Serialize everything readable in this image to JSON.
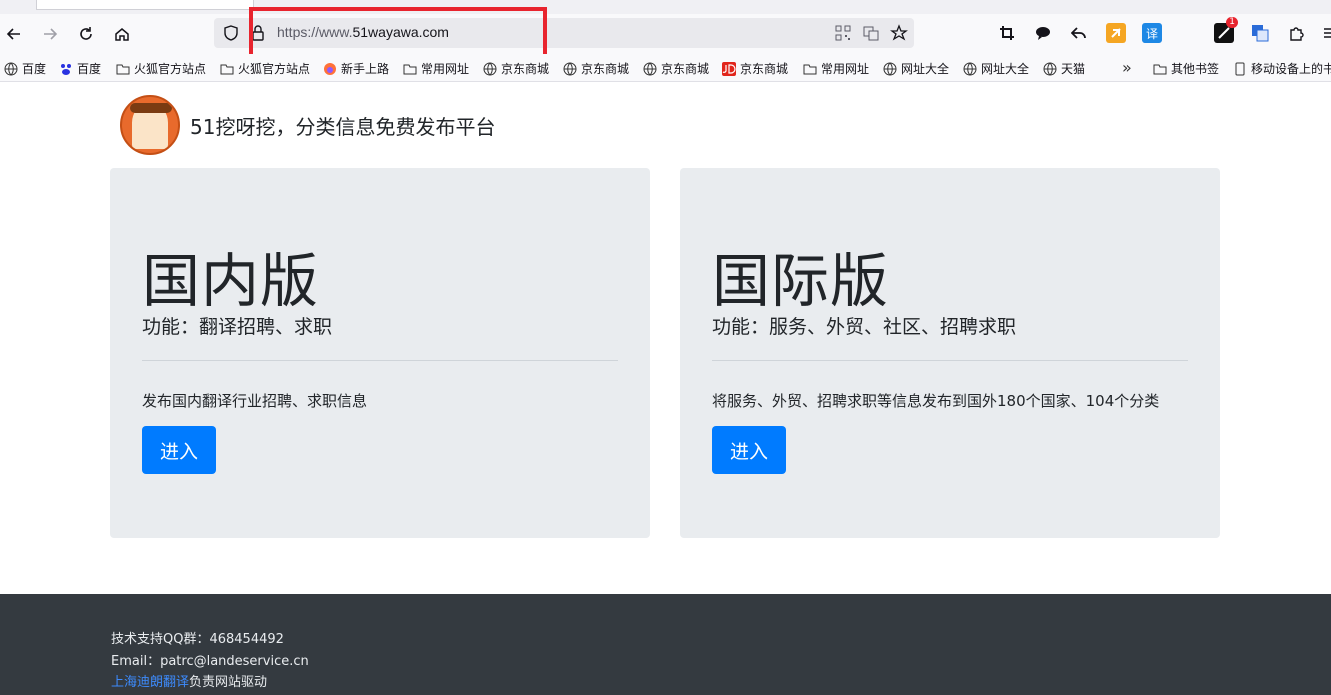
{
  "browser": {
    "url_prefix": "https://www.",
    "url_domain": "51wayawa.com",
    "bookmarks": [
      {
        "label": "百度",
        "icon": "globe-icon"
      },
      {
        "label": "百度",
        "icon": "baidu-paw-icon"
      },
      {
        "label": "火狐官方站点",
        "icon": "folder-icon"
      },
      {
        "label": "火狐官方站点",
        "icon": "folder-icon"
      },
      {
        "label": "新手上路",
        "icon": "firefox-icon"
      },
      {
        "label": "常用网址",
        "icon": "folder-icon"
      },
      {
        "label": "京东商城",
        "icon": "globe-icon"
      },
      {
        "label": "京东商城",
        "icon": "globe-icon"
      },
      {
        "label": "京东商城",
        "icon": "globe-icon"
      },
      {
        "label": "京东商城",
        "icon": "jd-icon"
      },
      {
        "label": "常用网址",
        "icon": "folder-icon"
      },
      {
        "label": "网址大全",
        "icon": "globe-icon"
      },
      {
        "label": "网址大全",
        "icon": "globe-icon"
      },
      {
        "label": "天猫",
        "icon": "globe-icon"
      },
      {
        "label": "其他书签",
        "icon": "folder-icon"
      },
      {
        "label": "移动设备上的书签",
        "icon": "mobile-icon"
      }
    ],
    "ext_translate_label": "译",
    "ext_badge": "1"
  },
  "site": {
    "title": "51挖呀挖，分类信息免费发布平台"
  },
  "cards": [
    {
      "title": "国内版",
      "subtitle": "功能：翻译招聘、求职",
      "description": "发布国内翻译行业招聘、求职信息",
      "button": "进入"
    },
    {
      "title": "国际版",
      "subtitle": "功能：服务、外贸、社区、招聘求职",
      "description": "将服务、外贸、招聘求职等信息发布到国外180个国家、104个分类",
      "button": "进入"
    }
  ],
  "footer": {
    "qq": "技术支持QQ群：468454492",
    "email": "Email：patrc@landeservice.cn",
    "link_text": "上海迪朗翻译",
    "powered_suffix": "负责网站驱动"
  },
  "colors": {
    "highlight": "#e8242e",
    "button": "#007bff",
    "footer_bg": "#343a40",
    "card_bg": "#e9ecef"
  }
}
